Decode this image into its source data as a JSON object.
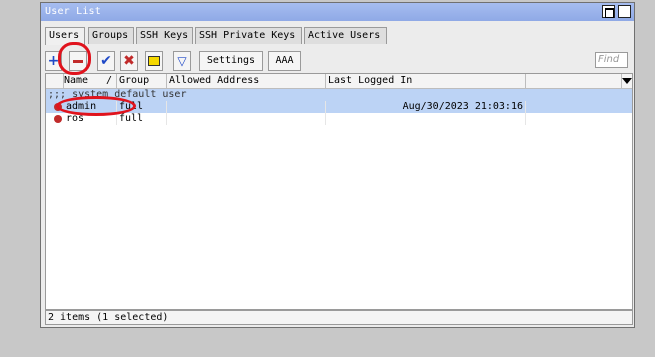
{
  "window": {
    "title": "User List"
  },
  "tabs": [
    "Users",
    "Groups",
    "SSH Keys",
    "SSH Private Keys",
    "Active Users"
  ],
  "toolbar": {
    "add_icon": "plus-icon",
    "remove_icon": "minus-icon",
    "enable_icon": "check-icon",
    "disable_icon": "x-icon",
    "comment_icon": "comment-icon",
    "filter_icon": "filter-icon",
    "settings_label": "Settings",
    "aaa_label": "AAA",
    "find_placeholder": "Find"
  },
  "table": {
    "headers": [
      "Name",
      "/",
      "Group",
      "Allowed Address",
      "Last Logged In"
    ],
    "group_comment": ";;; system default user",
    "rows": [
      {
        "name": "admin",
        "group": "full",
        "allowed_address": "",
        "last_logged_in": "Aug/30/2023 21:03:16",
        "selected": true
      },
      {
        "name": "ros",
        "group": "full",
        "allowed_address": "",
        "last_logged_in": "",
        "selected": false
      }
    ]
  },
  "status": "2 items (1 selected)",
  "colors": {
    "titlebar": "#98b0ea",
    "selection": "#bcd3f5",
    "annotation": "#e0131d",
    "user_icon": "#c12b2b"
  }
}
